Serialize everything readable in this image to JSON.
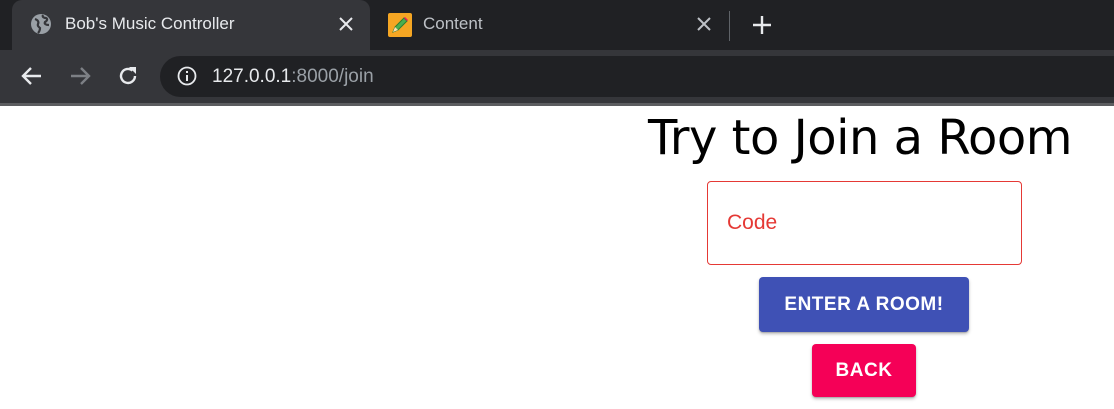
{
  "browser": {
    "tabs": [
      {
        "title": "Bob's Music Controller",
        "icon": "globe-icon",
        "active": true
      },
      {
        "title": "Content",
        "icon": "pencil-icon",
        "active": false
      }
    ],
    "address_bar": {
      "host": "127.0.0.1",
      "path": ":8000/join"
    }
  },
  "page": {
    "title": "Try to Join a Room",
    "code_field": {
      "placeholder": "Code",
      "value": ""
    },
    "enter_button_label": "ENTER A ROOM!",
    "back_button_label": "BACK"
  },
  "colors": {
    "enter_button": "#3f51b5",
    "back_button": "#f50057",
    "error_red": "#e53935"
  }
}
